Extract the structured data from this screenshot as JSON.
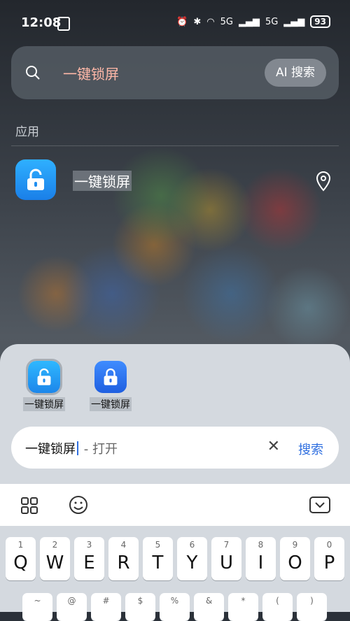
{
  "status": {
    "time": "12:08",
    "battery": "93",
    "network1": "5G",
    "network2": "5G"
  },
  "search": {
    "query": "一键锁屏",
    "ai_button": "AI 搜索"
  },
  "results": {
    "section_label": "应用",
    "apps": [
      {
        "name": "一键锁屏"
      }
    ]
  },
  "suggestions": [
    {
      "label": "一键锁屏"
    },
    {
      "label": "一键锁屏"
    }
  ],
  "input": {
    "value": "一键锁屏",
    "hint": " - 打开",
    "search_label": "搜索"
  },
  "keyboard": {
    "row1": [
      {
        "num": "1",
        "letter": "Q"
      },
      {
        "num": "2",
        "letter": "W"
      },
      {
        "num": "3",
        "letter": "E"
      },
      {
        "num": "4",
        "letter": "R"
      },
      {
        "num": "5",
        "letter": "T"
      },
      {
        "num": "6",
        "letter": "Y"
      },
      {
        "num": "7",
        "letter": "U"
      },
      {
        "num": "8",
        "letter": "I"
      },
      {
        "num": "9",
        "letter": "O"
      },
      {
        "num": "0",
        "letter": "P"
      }
    ],
    "row2_symbols": [
      "~",
      "@",
      "#",
      "$",
      "%",
      "&",
      "*",
      "(",
      ")"
    ]
  }
}
